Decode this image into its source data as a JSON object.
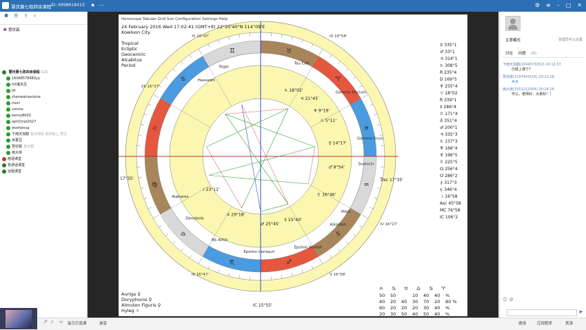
{
  "window": {
    "title": "慧伏晨七政四余课程",
    "room_id": "ID: 69986184",
    "viewers": "13"
  },
  "left": {
    "owner": "慧伏晨",
    "channel_title": "慧伏晨七政四余课程",
    "channel_count": "(13)",
    "members": [
      {
        "name": "16068578483yy",
        "tag": ""
      },
      {
        "name": "hill鬼先生",
        "tag": ""
      },
      {
        "name": "Jill",
        "tag": ""
      },
      {
        "name": "zhanwainaxiaine",
        "tag": ""
      },
      {
        "name": "moci",
        "tag": ""
      },
      {
        "name": "connie",
        "tag": ""
      },
      {
        "name": "kenny8003",
        "tag": ""
      },
      {
        "name": "optiChiat2027",
        "tag": ""
      },
      {
        "name": "woshanug",
        "tag": ""
      },
      {
        "name": "下雨天加醋",
        "tag": "看法用鼠 最好能上 表达"
      },
      {
        "name": "米香豆",
        "tag": ""
      },
      {
        "name": "慧伏晨",
        "tag": "登示器"
      },
      {
        "name": "雨大侠",
        "tag": ""
      }
    ],
    "sections": [
      "暗语课堂",
      "普通话课堂",
      "远程课堂"
    ]
  },
  "chart": {
    "date_line": "24 February 2016  Wed  17:02:41 (GMT+8) 22°20'40\"N  114°09'E",
    "place": "Kowloon City",
    "settings": [
      "Tropical",
      "Ecliptic",
      "Geocentric",
      "Alcabitus",
      "Period"
    ],
    "axis_labels": {
      "mc": "IX 16°58'",
      "asc": "Dsc 17°35'",
      "ic": "IC 15°55'",
      "left": "17°35'"
    },
    "house_labels": [
      "XI 16°47'",
      "XII 16°27'",
      "IX 16°58'",
      "IV 16°27'",
      "III 16°47'",
      "V 16°58'"
    ],
    "stars": [
      "Hassaleh",
      "Rigel",
      "Tau Ceti",
      "Gamma Piscium",
      "Gammo Gruis",
      "Sualocin",
      "Vega",
      "Alkaldah",
      "Epsilon Scorpii",
      "Epsilon Centauri",
      "Denebola",
      "Alpharex",
      "BS 4050"
    ],
    "planets": [
      {
        "glyph": "♄",
        "deg": "18°02'"
      },
      {
        "glyph": "♃",
        "deg": "21°45'"
      },
      {
        "glyph": "♆",
        "deg": "9°19'"
      },
      {
        "glyph": "☉",
        "deg": "5°11'"
      },
      {
        "glyph": "♀",
        "deg": "14°17'"
      },
      {
        "glyph": "♂",
        "deg": "8°54'"
      },
      {
        "glyph": "♇",
        "deg": "16°46'"
      },
      {
        "glyph": "☿",
        "deg": "15°40'"
      },
      {
        "glyph": "♂",
        "deg": "25°45'"
      },
      {
        "glyph": "♃",
        "deg": "29°18'"
      },
      {
        "glyph": "☽",
        "deg": "23°11'"
      }
    ],
    "positions": [
      "♀ 335°1",
      "♂ 33°1",
      "♃ 314°1",
      "♄ 308°5",
      "R 235°4",
      "D 169°5",
      "♆ 255°4",
      "☉ 18°02",
      "R 339°1",
      "☿ 286°4",
      "♇ 171°4",
      "♁ 351°4",
      "♂ 200°1",
      "♃ 335°3",
      "♄ 137°3",
      "♅ 166°4",
      "♆ 196°5",
      "♇ 225°5",
      "☊ 256°4",
      "☋ 286°2",
      "⚷ 317°3",
      "⚸ 346°4",
      "☽ 16°58",
      "Asc 45°58",
      "MC 76°58",
      "IC 106°2"
    ],
    "stats_header": [
      "≏",
      "♋",
      "♉",
      "♎",
      "♋",
      "♈"
    ],
    "stats_rows": [
      [
        "50",
        "50",
        "",
        "10",
        "40",
        "40",
        "%"
      ],
      [
        "40",
        "20",
        "40",
        "30",
        "70",
        "20",
        "80 %"
      ],
      [
        "60",
        "20",
        "20",
        "20",
        "30",
        "40",
        "%"
      ],
      [
        "20",
        "30",
        "50",
        "40",
        "50",
        "40",
        "%"
      ]
    ],
    "footer": [
      "Auriga  ♀",
      "Doryphoros  ♀",
      "Almuten Figuris  ♀",
      "Hyleg  ☉"
    ],
    "tabs_top": [
      "Horoscope",
      "Tabular",
      "Grid",
      "Sun",
      "Configuration",
      "Settings",
      "Help"
    ]
  },
  "right": {
    "mode": "主席模式",
    "link": "管理员可以设置",
    "tabs": [
      "讨论",
      "问题",
      "(0)"
    ],
    "messages": [
      {
        "meta": "下雨天加醋(2044573352) 20:12:37",
        "text": "已经上课了?"
      },
      {
        "meta": "慧伏晨(1197443155) 20:13:28",
        "text": "木瓜"
      },
      {
        "meta": "雨大侠(1551213354) 20:24:26",
        "text": "可以，老师好，大家好！！"
      }
    ]
  },
  "bottom": {
    "labels": [
      "指引打造课",
      "录音"
    ],
    "right_labels": [
      "邀请",
      "应用程序",
      "表演"
    ]
  }
}
